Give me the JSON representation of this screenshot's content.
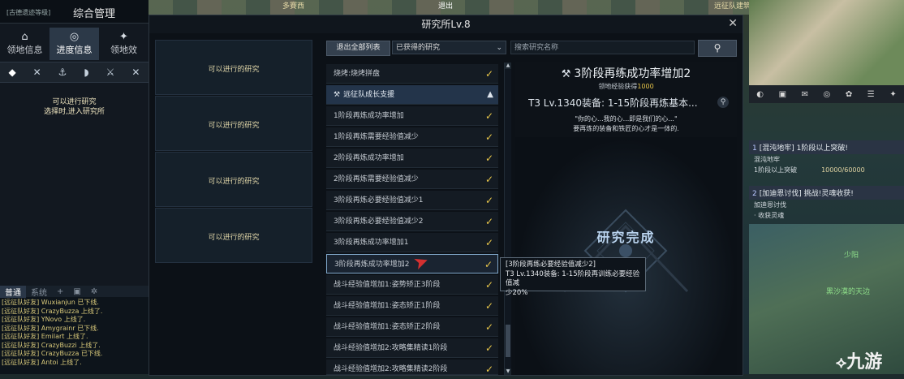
{
  "top_bar": {
    "location_tag": "多賽西",
    "exit_label": "退出",
    "right_tag": "远征队建筑"
  },
  "left_panel": {
    "tag": "[古德遗迹等级]",
    "title": "综合管理",
    "tabs": [
      {
        "label": "领地信息",
        "icon": "castle-icon"
      },
      {
        "label": "进度信息",
        "icon": "compass-icon",
        "active": true
      },
      {
        "label": "领地效",
        "icon": "sparkle-icon"
      }
    ],
    "toolbar_icons": [
      "graduation-cap-icon",
      "tools-icon",
      "anchor-icon",
      "ship-icon",
      "crossed-axes-icon",
      "crossed-swords-icon"
    ],
    "message_line1": "可以进行研究",
    "message_line2": "选择时,进入研究所"
  },
  "chat": {
    "tabs": [
      {
        "label": "普通",
        "active": true
      },
      {
        "label": "系统"
      }
    ],
    "add_label": "+",
    "lines": [
      "[远征队好友] Wuxianjun 已下线.",
      "[远征队好友] CrazyBuzza 上线了.",
      "[远征队好友] YNovo 上线了.",
      "[远征队好友] Amygrainr 已下线.",
      "[远征队好友] Emilart 上线了.",
      "[远征队好友] CrazyBuzzi 上线了.",
      "[远征队好友] CrazyBuzza 已下线.",
      "[远征队好友] Antoi 上线了."
    ]
  },
  "dialog": {
    "title": "研究所Lv.8",
    "close_icon": "close-icon",
    "slots": [
      "可以进行的研究",
      "可以进行的研究",
      "可以进行的研究",
      "可以进行的研究"
    ],
    "exit_all_label": "退出全部列表",
    "filter_value": "已获得的研究",
    "search_placeholder": "搜索研究名称",
    "search_icon": "search-icon",
    "list": [
      {
        "label": "烧烤:烧烤拼盘",
        "type": "item"
      },
      {
        "label": "远征队成长支援",
        "type": "group"
      },
      {
        "label": "1阶段再炼成功率增加",
        "type": "item"
      },
      {
        "label": "1阶段再炼需要经验值减少",
        "type": "item"
      },
      {
        "label": "2阶段再炼成功率增加",
        "type": "item"
      },
      {
        "label": "2阶段再炼需要经验值减少",
        "type": "item"
      },
      {
        "label": "3阶段再炼必要经验值减少1",
        "type": "item"
      },
      {
        "label": "3阶段再炼必要经验值减少2",
        "type": "item"
      },
      {
        "label": "3阶段再炼成功率增加1",
        "type": "item"
      },
      {
        "label": "3阶段再炼成功率增加2",
        "type": "item",
        "selected": true
      },
      {
        "label": "战斗经验值增加1:姿势矫正3阶段",
        "type": "item"
      },
      {
        "label": "战斗经验值增加1:姿态矫正1阶段",
        "type": "item"
      },
      {
        "label": "战斗经验值增加1:姿态矫正2阶段",
        "type": "item"
      },
      {
        "label": "战斗经验值增加2:攻略集精读1阶段",
        "type": "item"
      },
      {
        "label": "战斗经验值增加2:攻略集精读2阶段",
        "type": "item"
      }
    ],
    "detail": {
      "title": "3阶段再练成功率增加2",
      "sub_prefix": "领地经验获得",
      "sub_value": "1000",
      "equip_line": "T3 Lv.1340装备: 1-15阶段再炼基本...",
      "quote1": "\"你的心...我的心...即是我们的心...\"",
      "quote2": "要再炼的装备和铁匠的心才是一体的.",
      "complete_label": "研究完成"
    },
    "tooltip": {
      "line1": "[3阶段再练必要经验值减少2]",
      "line2": "T3 Lv.1340装备: 1-15阶段再训练必要经验值减",
      "line3": "少20%"
    }
  },
  "hud": {
    "quests": [
      {
        "num": "1",
        "title": "[混沌地牢] 1阶段以上突破!",
        "sub1": "混沌地牢",
        "sub2": "1阶段以上突破",
        "progress": "10000/60000"
      },
      {
        "num": "2",
        "title": "[加迪恩讨伐] 挑战!灵魂收获!",
        "sub1": "加迪恩讨伐",
        "sub2": "· 收获灵魂"
      }
    ],
    "scene_labels": [
      "少阳",
      "黑沙漠的天边"
    ],
    "watermark": "九游"
  },
  "colors": {
    "accent_gold": "#e8c64a",
    "dialog_bg": "#0c1117",
    "group_row": "#23344a"
  }
}
